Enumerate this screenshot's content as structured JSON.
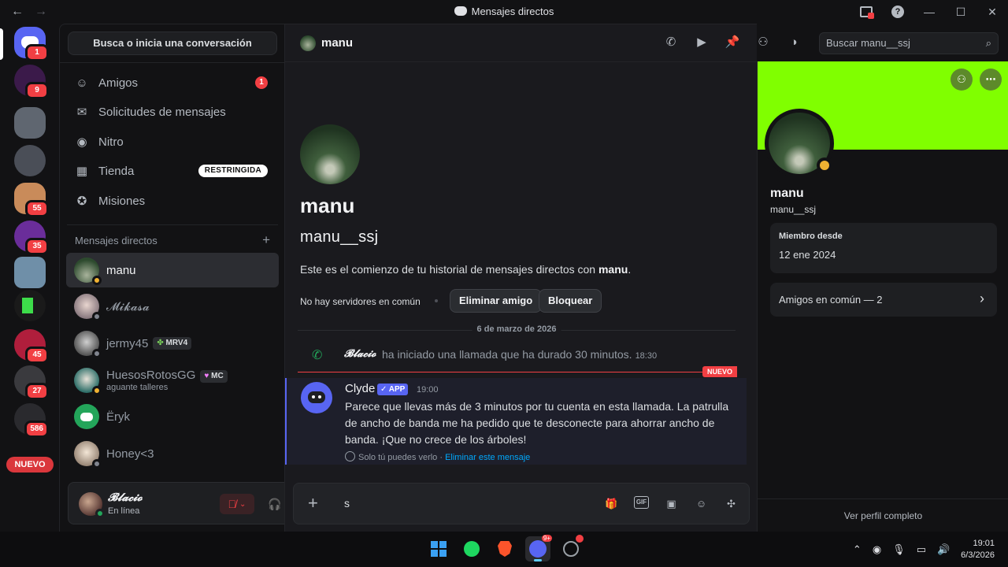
{
  "window": {
    "title": "Mensajes directos",
    "back_icon": "arrow-left",
    "forward_icon": "arrow-right"
  },
  "rail": {
    "home_badge": "1",
    "servers": [
      {
        "badge": "9",
        "color": "#3b1a4a"
      },
      {
        "badge": "",
        "color": "#5f6670"
      },
      {
        "badge": "",
        "color": "#4a4e57"
      },
      {
        "badge": "55",
        "color": "#c98b5a"
      },
      {
        "badge": "35",
        "color": "#6a2d9a"
      },
      {
        "badge": "",
        "color": "#6f8fa8"
      },
      {
        "badge": "",
        "color": "#1a1a1a"
      },
      {
        "badge": "45",
        "color": "#b01e3c"
      },
      {
        "badge": "27",
        "color": "#3a3a3e"
      },
      {
        "badge": "586",
        "color": "#2a2a2e"
      }
    ],
    "new_label": "NUEVO"
  },
  "sidebar": {
    "search_label": "Busca o inicia una conversación",
    "nav": [
      {
        "label": "Amigos",
        "icon": "friends-icon",
        "count": "1"
      },
      {
        "label": "Solicitudes de mensajes",
        "icon": "mail-icon"
      },
      {
        "label": "Nitro",
        "icon": "nitro-icon"
      },
      {
        "label": "Tienda",
        "icon": "shop-icon",
        "tag": "RESTRINGIDA"
      },
      {
        "label": "Misiones",
        "icon": "quests-icon"
      }
    ],
    "dm_header": "Mensajes directos",
    "dms": [
      {
        "name": "manu",
        "status": "idle",
        "active": true
      },
      {
        "name": "𝓜𝓲𝓴𝓪𝓼𝓪",
        "status": "offline"
      },
      {
        "name": "jermy45",
        "tag": "MRV4",
        "status": "offline"
      },
      {
        "name": "HuesosRotosGG",
        "tag": "MC",
        "sub": "aguante talleres",
        "status": "idle"
      },
      {
        "name": "Ëryk",
        "status": "none"
      },
      {
        "name": "Honey<3",
        "status": "offline"
      }
    ]
  },
  "user": {
    "name": "𝓑𝓵𝓪𝓬𝓲𝓸",
    "status": "En línea"
  },
  "chat": {
    "header_name": "manu",
    "search_placeholder": "Buscar manu__ssj",
    "intro_name": "manu",
    "intro_username": "manu__ssj",
    "intro_text_prefix": "Este es el comienzo de tu historial de mensajes directos con ",
    "intro_text_name": "manu",
    "intro_text_suffix": ".",
    "mutual_servers": "No hay servidores en común",
    "remove_friend": "Eliminar amigo",
    "block": "Bloquear",
    "date_divider": "6 de marzo de 2026",
    "call": {
      "who": "𝓑𝓵𝓪𝓬𝓲𝓸",
      "text": "ha iniciado una llamada que ha durado 30 minutos.",
      "time": "18:30"
    },
    "new_label": "NUEVO",
    "clyde": {
      "name": "Clyde",
      "tag": "✓ APP",
      "time": "19:00",
      "body": "Parece que llevas más de 3 minutos por tu cuenta en esta llamada. La patrulla de ancho de banda me ha pedido que te desconecte para ahorrar ancho de banda. ¡Que no crece de los árboles!",
      "only_you": "Solo tú puedes verlo",
      "separator": " · ",
      "delete": "Eliminar este mensaje"
    },
    "composer_text": "s"
  },
  "profile": {
    "banner_color": "#80ff00",
    "name": "manu",
    "username": "manu__ssj",
    "member_since_label": "Miembro desde",
    "member_since": "12 ene 2024",
    "mutual_friends": "Amigos en común — 2",
    "view_full": "Ver perfil completo"
  },
  "taskbar": {
    "time": "19:01",
    "date": "6/3/2026",
    "discord_badge": "9+"
  }
}
